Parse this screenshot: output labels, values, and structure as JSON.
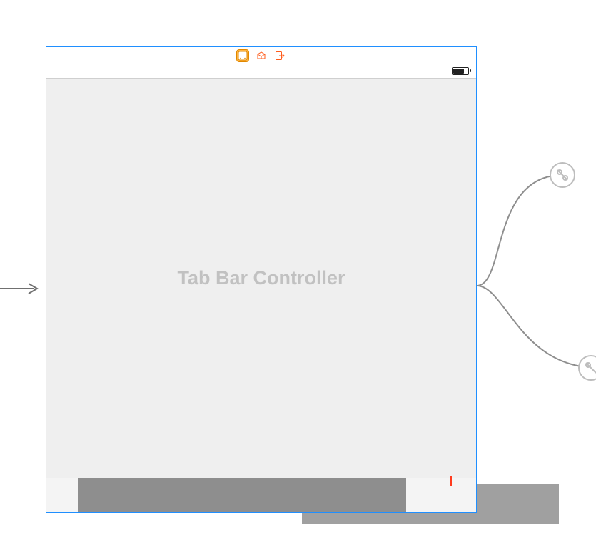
{
  "scene": {
    "placeholder_title": "Tab Bar Controller",
    "dock": {
      "controller_icon": "tab-bar-controller-icon",
      "first_responder_icon": "first-responder-icon",
      "exit_icon": "exit-icon"
    },
    "status_bar": {
      "battery": true
    }
  }
}
